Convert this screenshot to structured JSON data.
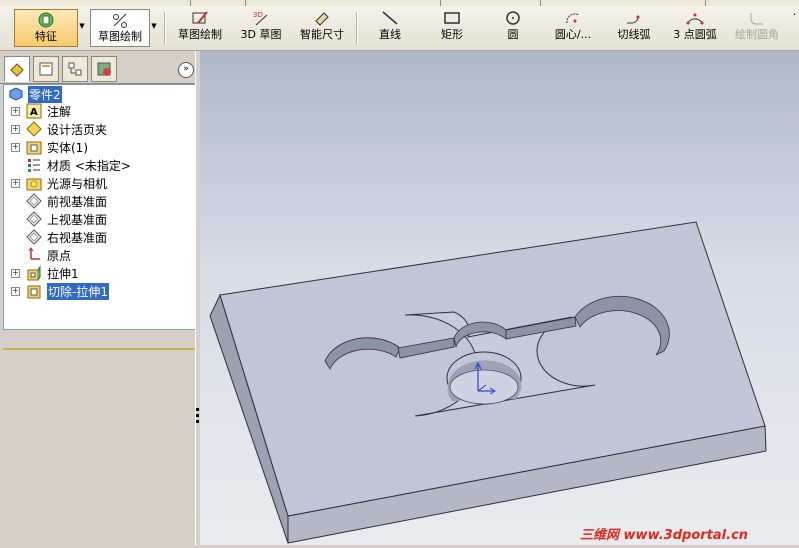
{
  "toolbar": {
    "feature_label": "特征",
    "sketch_command_label": "草图绘制",
    "items": [
      {
        "label": "草图绘制",
        "icon": "sketch-icon"
      },
      {
        "label": "3D 草图",
        "icon": "sketch-3d-icon"
      },
      {
        "label": "智能尺寸",
        "icon": "smart-dimension-icon"
      },
      {
        "label": "直线",
        "icon": "line-icon"
      },
      {
        "label": "矩形",
        "icon": "rectangle-icon"
      },
      {
        "label": "圆",
        "icon": "circle-icon"
      },
      {
        "label": "圆心/...",
        "icon": "centerpoint-arc-icon"
      },
      {
        "label": "切线弧",
        "icon": "tangent-arc-icon"
      },
      {
        "label": "3 点圆弧",
        "icon": "three-point-arc-icon"
      },
      {
        "label": "绘制圆角",
        "icon": "sketch-fillet-icon"
      }
    ]
  },
  "tree": {
    "root": "零件2",
    "items": [
      {
        "label": "注解",
        "icon": "annotations-icon",
        "expandable": true
      },
      {
        "label": "设计活页夹",
        "icon": "design-binder-icon",
        "expandable": true
      },
      {
        "label": "实体(1)",
        "icon": "solid-bodies-icon",
        "expandable": true
      },
      {
        "label": "材质 <未指定>",
        "icon": "material-icon",
        "expandable": false
      },
      {
        "label": "光源与相机",
        "icon": "lights-cameras-icon",
        "expandable": true
      },
      {
        "label": "前视基准面",
        "icon": "plane-icon",
        "expandable": false
      },
      {
        "label": "上视基准面",
        "icon": "plane-icon",
        "expandable": false
      },
      {
        "label": "右视基准面",
        "icon": "plane-icon",
        "expandable": false
      },
      {
        "label": "原点",
        "icon": "origin-icon",
        "expandable": false
      },
      {
        "label": "拉伸1",
        "icon": "extrude-icon",
        "expandable": true
      },
      {
        "label": "切除-拉伸1",
        "icon": "cut-extrude-icon",
        "expandable": true
      }
    ]
  },
  "watermark": {
    "brand": "三维网",
    "url": "www.3dportal.cn"
  },
  "colors": {
    "selection": "#316ac5",
    "accent": "#e0281c"
  }
}
